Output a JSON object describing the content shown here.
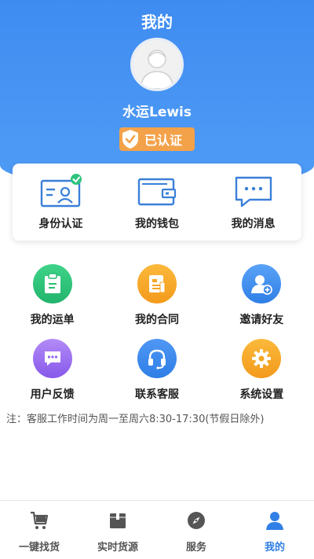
{
  "header": {
    "title": "我的",
    "username": "水运Lewis",
    "verified_label": "已认证"
  },
  "quick_actions": [
    {
      "label": "身份认证",
      "icon": "id-card-check-icon"
    },
    {
      "label": "我的钱包",
      "icon": "wallet-icon"
    },
    {
      "label": "我的消息",
      "icon": "message-icon"
    }
  ],
  "grid_items": [
    {
      "label": "我的运单",
      "icon": "clipboard-icon",
      "color": "#2fc47d"
    },
    {
      "label": "我的合同",
      "icon": "document-icon",
      "color": "#f5a623"
    },
    {
      "label": "邀请好友",
      "icon": "add-user-icon",
      "color": "#3b86ee"
    },
    {
      "label": "用户反馈",
      "icon": "chat-bubble-icon",
      "color": "#9b6cf0"
    },
    {
      "label": "联系客服",
      "icon": "headset-icon",
      "color": "#3b86ee"
    },
    {
      "label": "系统设置",
      "icon": "gear-icon",
      "color": "#f5a623"
    }
  ],
  "notice": "注：客服工作时间为周一至周六8:30-17:30(节假日除外)",
  "tabbar": [
    {
      "label": "一键找货",
      "icon": "cart-icon",
      "active": false
    },
    {
      "label": "实时货源",
      "icon": "package-icon",
      "active": false
    },
    {
      "label": "服务",
      "icon": "compass-icon",
      "active": false
    },
    {
      "label": "我的",
      "icon": "person-icon",
      "active": true
    }
  ],
  "colors": {
    "primary": "#3f8cf1",
    "badge": "#f3a24a",
    "active_tab": "#2f7fe6"
  }
}
